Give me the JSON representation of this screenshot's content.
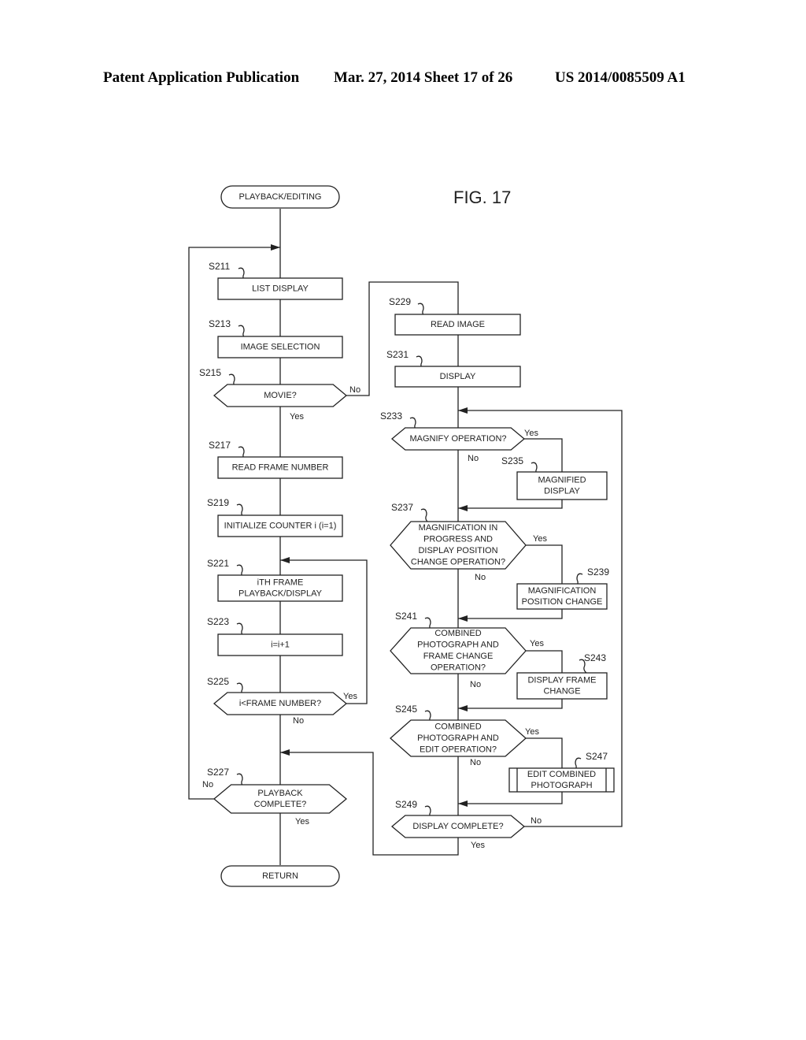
{
  "header": {
    "left": "Patent Application Publication",
    "middle": "Mar. 27, 2014  Sheet 17 of 26",
    "right": "US 2014/0085509 A1"
  },
  "figure_label": "FIG. 17",
  "terminals": {
    "start": "PLAYBACK/EDITING",
    "end": "RETURN"
  },
  "steps": {
    "S211": {
      "id": "S211",
      "lines": [
        "LIST DISPLAY"
      ]
    },
    "S213": {
      "id": "S213",
      "lines": [
        "IMAGE SELECTION"
      ]
    },
    "S215": {
      "id": "S215",
      "lines": [
        "MOVIE?"
      ],
      "yes": "Yes",
      "no": "No"
    },
    "S217": {
      "id": "S217",
      "lines": [
        "READ FRAME NUMBER"
      ]
    },
    "S219": {
      "id": "S219",
      "lines": [
        "INITIALIZE COUNTER i (i=1)"
      ]
    },
    "S221": {
      "id": "S221",
      "lines": [
        "iTH FRAME",
        "PLAYBACK/DISPLAY"
      ]
    },
    "S223": {
      "id": "S223",
      "lines": [
        "i=i+1"
      ]
    },
    "S225": {
      "id": "S225",
      "lines": [
        "i<FRAME NUMBER?"
      ],
      "yes": "Yes",
      "no": "No"
    },
    "S227": {
      "id": "S227",
      "lines": [
        "PLAYBACK",
        "COMPLETE?"
      ],
      "yes": "Yes",
      "no": "No"
    },
    "S229": {
      "id": "S229",
      "lines": [
        "READ IMAGE"
      ]
    },
    "S231": {
      "id": "S231",
      "lines": [
        "DISPLAY"
      ]
    },
    "S233": {
      "id": "S233",
      "lines": [
        "MAGNIFY OPERATION?"
      ],
      "yes": "Yes",
      "no": "No"
    },
    "S235": {
      "id": "S235",
      "lines": [
        "MAGNIFIED",
        "DISPLAY"
      ]
    },
    "S237": {
      "id": "S237",
      "lines": [
        "MAGNIFICATION IN",
        "PROGRESS AND",
        "DISPLAY POSITION",
        "CHANGE OPERATION?"
      ],
      "yes": "Yes",
      "no": "No"
    },
    "S239": {
      "id": "S239",
      "lines": [
        "MAGNIFICATION",
        "POSITION CHANGE"
      ]
    },
    "S241": {
      "id": "S241",
      "lines": [
        "COMBINED",
        "PHOTOGRAPH AND",
        "FRAME CHANGE",
        "OPERATION?"
      ],
      "yes": "Yes",
      "no": "No"
    },
    "S243": {
      "id": "S243",
      "lines": [
        "DISPLAY FRAME",
        "CHANGE"
      ]
    },
    "S245": {
      "id": "S245",
      "lines": [
        "COMBINED",
        "PHOTOGRAPH AND",
        "EDIT OPERATION?"
      ],
      "yes": "Yes",
      "no": "No"
    },
    "S247": {
      "id": "S247",
      "lines": [
        "EDIT COMBINED",
        "PHOTOGRAPH"
      ]
    },
    "S249": {
      "id": "S249",
      "lines": [
        "DISPLAY COMPLETE?"
      ],
      "yes": "Yes",
      "no": "No"
    }
  }
}
